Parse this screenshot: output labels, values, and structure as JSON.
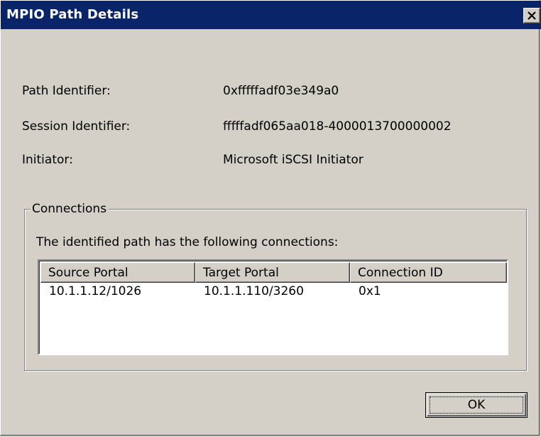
{
  "window": {
    "title": "MPIO Path Details",
    "close_icon": "close-icon"
  },
  "details": {
    "path_identifier_label": "Path Identifier:",
    "path_identifier_value": "0xfffffadf03e349a0",
    "session_identifier_label": "Session Identifier:",
    "session_identifier_value": "fffffadf065aa018-4000013700000002",
    "initiator_label": "Initiator:",
    "initiator_value": "Microsoft iSCSI Initiator"
  },
  "connections": {
    "group_title": "Connections",
    "description": "The identified path has the following connections:",
    "columns": [
      "Source Portal",
      "Target Portal",
      "Connection ID"
    ],
    "rows": [
      [
        "10.1.1.12/1026",
        "10.1.1.110/3260",
        "0x1"
      ]
    ]
  },
  "buttons": {
    "ok_label": "OK"
  },
  "colors": {
    "title_bar": "#0a246a",
    "face": "#d4d0c8"
  }
}
